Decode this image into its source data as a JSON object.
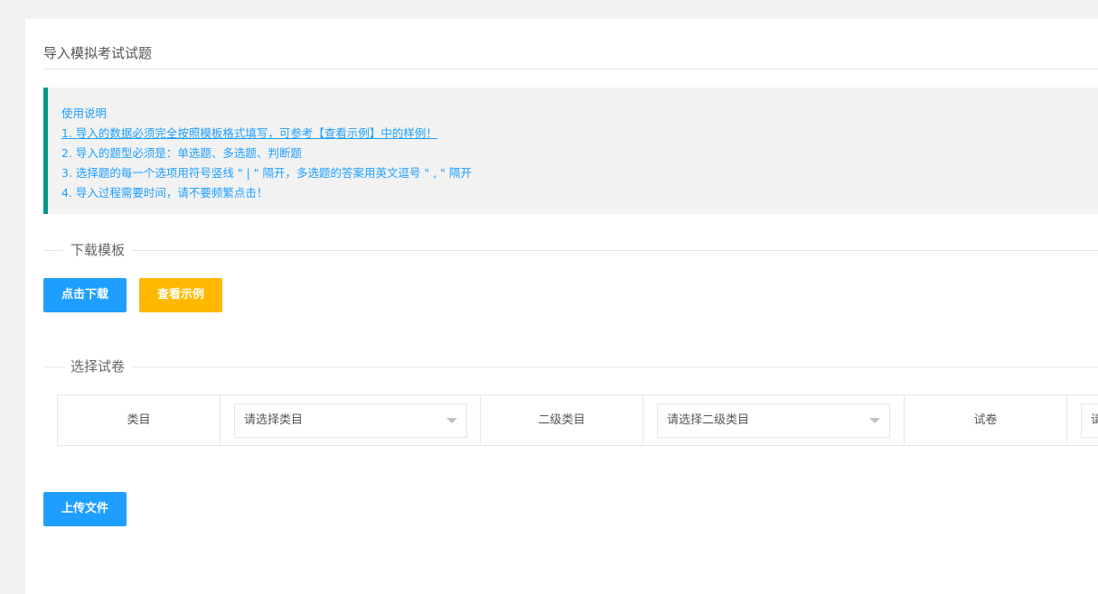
{
  "page": {
    "title": "导入模拟考试试题"
  },
  "instructions": {
    "heading": "使用说明",
    "items": [
      "1. 导入的数据必须完全按照模板格式填写，可参考【查看示例】中的样例！",
      "2. 导入的题型必须是：单选题、多选题、判断题",
      "3. 选择题的每一个选项用符号竖线 \" | \" 隔开，多选题的答案用英文逗号 \" , \" 隔开",
      "4. 导入过程需要时间，请不要频繁点击！"
    ]
  },
  "download_section": {
    "title": "下载模板",
    "download_button": "点击下载",
    "example_button": "查看示例"
  },
  "paper_section": {
    "title": "选择试卷",
    "category_label": "类目",
    "category_placeholder": "请选择类目",
    "subcategory_label": "二级类目",
    "subcategory_placeholder": "请选择二级类目",
    "paper_label": "试卷",
    "paper_placeholder": "请"
  },
  "upload_button": "上传文件",
  "colors": {
    "accent_blue": "#1e9fff",
    "accent_yellow": "#ffb800",
    "notice_border": "#009688"
  }
}
